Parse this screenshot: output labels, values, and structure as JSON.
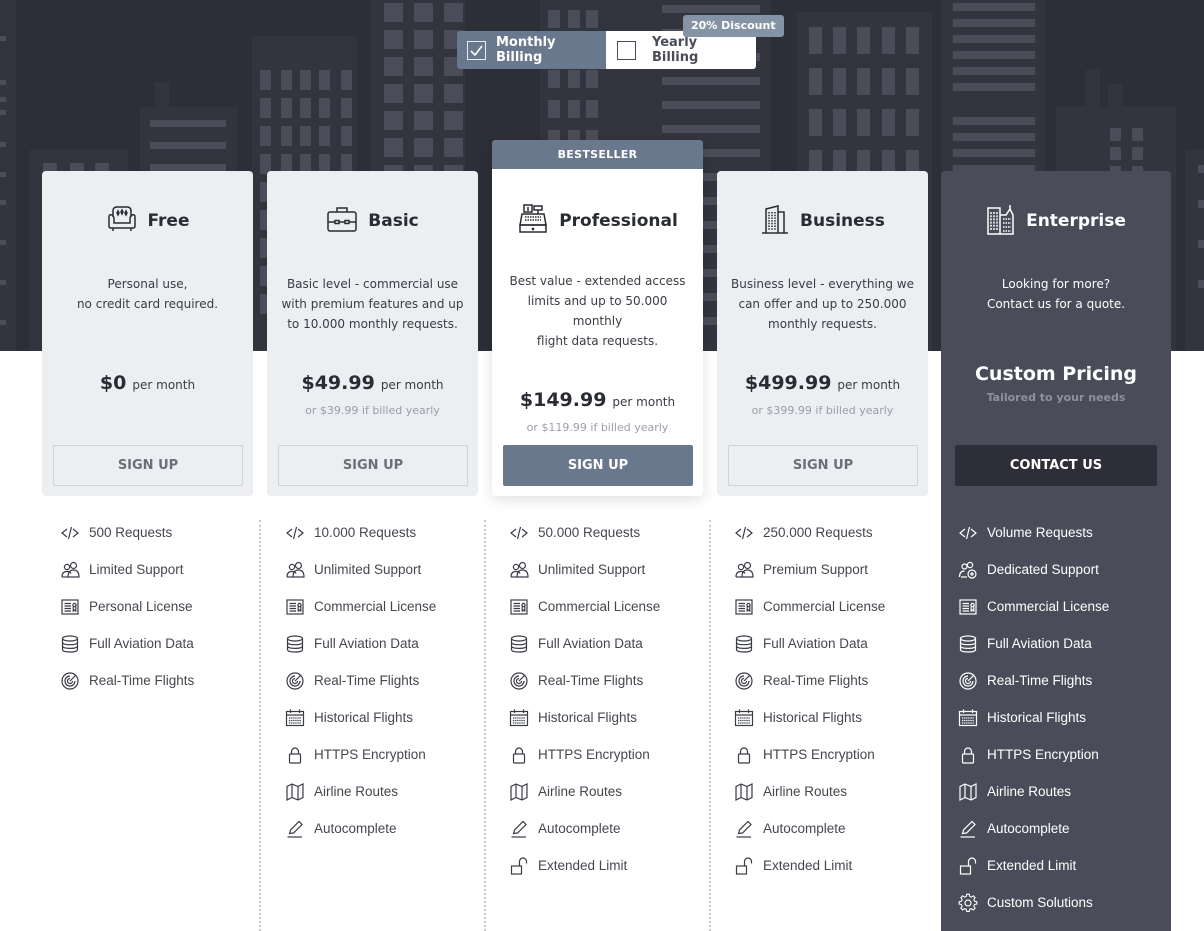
{
  "billing": {
    "monthly_label": "Monthly Billing",
    "monthly_checked": true,
    "yearly_label": "Yearly Billing",
    "yearly_checked": false,
    "discount_badge": "20% Discount"
  },
  "colors": {
    "hero_bg": "#2d2f38",
    "accent": "#6a788d",
    "enterprise_bg": "#4a4d59",
    "contact_button_bg": "#2d2e37"
  },
  "plans": [
    {
      "name": "Free",
      "icon": "armchair-icon",
      "description": [
        "Personal use,",
        "no credit card required."
      ],
      "price": "$0",
      "per": "per month",
      "yearly_note": "",
      "button": "SIGN UP",
      "features": [
        {
          "icon": "code-icon",
          "label": "500 Requests"
        },
        {
          "icon": "users-icon",
          "label": "Limited Support"
        },
        {
          "icon": "license-icon",
          "label": "Personal License"
        },
        {
          "icon": "database-icon",
          "label": "Full Aviation Data"
        },
        {
          "icon": "radar-icon",
          "label": "Real-Time Flights"
        }
      ]
    },
    {
      "name": "Basic",
      "icon": "briefcase-icon",
      "description": [
        "Basic level - commercial use",
        "with premium features and up",
        "to 10.000 monthly requests."
      ],
      "price": "$49.99",
      "per": "per month",
      "yearly_note": "or $39.99 if billed yearly",
      "button": "SIGN UP",
      "features": [
        {
          "icon": "code-icon",
          "label": "10.000 Requests"
        },
        {
          "icon": "users-icon",
          "label": "Unlimited Support"
        },
        {
          "icon": "license-icon",
          "label": "Commercial License"
        },
        {
          "icon": "database-icon",
          "label": "Full Aviation Data"
        },
        {
          "icon": "radar-icon",
          "label": "Real-Time Flights"
        },
        {
          "icon": "calendar-icon",
          "label": "Historical Flights"
        },
        {
          "icon": "lock-icon",
          "label": "HTTPS Encryption"
        },
        {
          "icon": "map-icon",
          "label": "Airline Routes"
        },
        {
          "icon": "pencil-icon",
          "label": "Autocomplete"
        }
      ]
    },
    {
      "name": "Professional",
      "icon": "cash-register-icon",
      "ribbon": "BESTSELLER",
      "description": [
        "Best value - extended access",
        "limits and up to 50.000 monthly",
        "flight data requests."
      ],
      "price": "$149.99",
      "per": "per month",
      "yearly_note": "or $119.99 if billed yearly",
      "button": "SIGN UP",
      "features": [
        {
          "icon": "code-icon",
          "label": "50.000 Requests"
        },
        {
          "icon": "users-icon",
          "label": "Unlimited Support"
        },
        {
          "icon": "license-icon",
          "label": "Commercial License"
        },
        {
          "icon": "database-icon",
          "label": "Full Aviation Data"
        },
        {
          "icon": "radar-icon",
          "label": "Real-Time Flights"
        },
        {
          "icon": "calendar-icon",
          "label": "Historical Flights"
        },
        {
          "icon": "lock-icon",
          "label": "HTTPS Encryption"
        },
        {
          "icon": "map-icon",
          "label": "Airline Routes"
        },
        {
          "icon": "pencil-icon",
          "label": "Autocomplete"
        },
        {
          "icon": "unlock-icon",
          "label": "Extended Limit"
        }
      ]
    },
    {
      "name": "Business",
      "icon": "office-building-icon",
      "description": [
        "Business level - everything we",
        "can offer and up to 250.000",
        "monthly requests."
      ],
      "price": "$499.99",
      "per": "per month",
      "yearly_note": "or $399.99 if billed yearly",
      "button": "SIGN UP",
      "features": [
        {
          "icon": "code-icon",
          "label": "250.000 Requests"
        },
        {
          "icon": "users-icon",
          "label": "Premium Support"
        },
        {
          "icon": "license-icon",
          "label": "Commercial License"
        },
        {
          "icon": "database-icon",
          "label": "Full Aviation Data"
        },
        {
          "icon": "radar-icon",
          "label": "Real-Time Flights"
        },
        {
          "icon": "calendar-icon",
          "label": "Historical Flights"
        },
        {
          "icon": "lock-icon",
          "label": "HTTPS Encryption"
        },
        {
          "icon": "map-icon",
          "label": "Airline Routes"
        },
        {
          "icon": "pencil-icon",
          "label": "Autocomplete"
        },
        {
          "icon": "unlock-icon",
          "label": "Extended Limit"
        }
      ]
    },
    {
      "name": "Enterprise",
      "icon": "skyscrapers-icon",
      "description": [
        "Looking for more?",
        "Contact us for a quote."
      ],
      "price": "Custom Pricing",
      "price_sub": "Tailored to your needs",
      "button": "CONTACT US",
      "features": [
        {
          "icon": "code-icon",
          "label": "Volume Requests"
        },
        {
          "icon": "users-plus-icon",
          "label": "Dedicated Support"
        },
        {
          "icon": "license-icon",
          "label": "Commercial License"
        },
        {
          "icon": "database-icon",
          "label": "Full Aviation Data"
        },
        {
          "icon": "radar-icon",
          "label": "Real-Time Flights"
        },
        {
          "icon": "calendar-icon",
          "label": "Historical Flights"
        },
        {
          "icon": "lock-icon",
          "label": "HTTPS Encryption"
        },
        {
          "icon": "map-icon",
          "label": "Airline Routes"
        },
        {
          "icon": "pencil-icon",
          "label": "Autocomplete"
        },
        {
          "icon": "unlock-icon",
          "label": "Extended Limit"
        },
        {
          "icon": "gear-icon",
          "label": "Custom Solutions"
        }
      ]
    }
  ]
}
